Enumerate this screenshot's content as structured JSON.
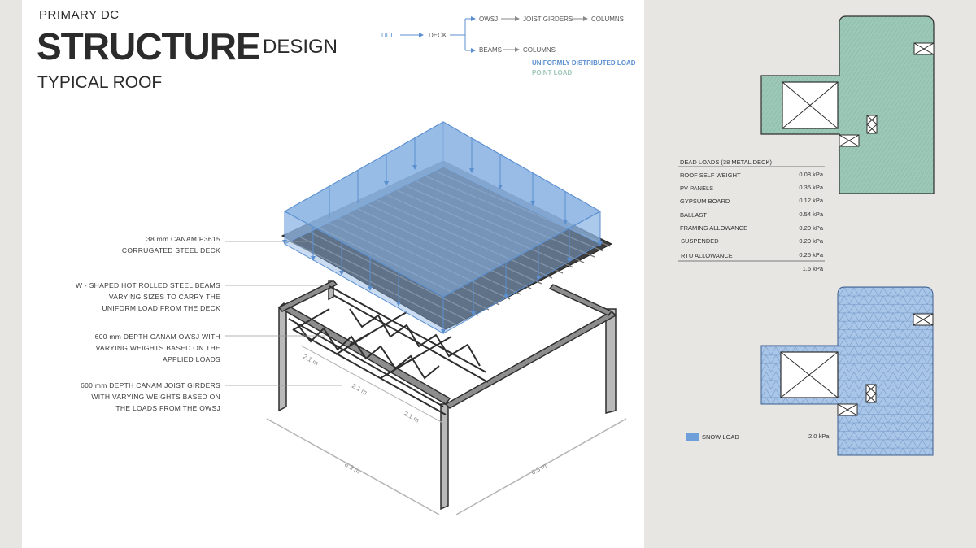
{
  "header": {
    "kicker": "PRIMARY DC",
    "title": "STRUCTURE",
    "title_suffix": "DESIGN",
    "subtitle": "TYPICAL ROOF"
  },
  "load_path": {
    "start": "UDL",
    "deck": "DECK",
    "owsj": "OWSJ",
    "joist_girders": "JOIST GIRDERS",
    "columns_top": "COLUMNS",
    "beams": "BEAMS",
    "columns_bottom": "COLUMNS"
  },
  "legend": {
    "udl": "UNIFORMLY DISTRIBUTED LOAD",
    "point": "POINT LOAD"
  },
  "callouts": {
    "deck": [
      "38 mm CANAM P3615",
      "CORRUGATED STEEL DECK"
    ],
    "beams": [
      "W - SHAPED HOT ROLLED STEEL BEAMS",
      "VARYING SIZES TO CARRY THE",
      "UNIFORM LOAD FROM THE DECK"
    ],
    "owsj": [
      "600 mm DEPTH CANAM OWSJ WITH",
      "VARYING WEIGHTS BASED ON THE",
      "APPLIED LOADS"
    ],
    "girders": [
      "600 mm DEPTH CANAM JOIST GIRDERS",
      "WITH VARYING WEIGHTS BASED ON",
      "THE LOADS FROM THE OWSJ"
    ]
  },
  "dimensions": {
    "bay_spacing": "2.1 m",
    "width": "6.3 m",
    "depth": "6.3 m"
  },
  "dead_loads": {
    "title": "DEAD LOADS (38 METAL DECK)",
    "rows": [
      {
        "label": "ROOF SELF WEIGHT",
        "value": "0.08 kPa"
      },
      {
        "label": "PV PANELS",
        "value": "0.35 kPa"
      },
      {
        "label": "GYPSUM BOARD",
        "value": "0.12 kPa"
      },
      {
        "label": "BALLAST",
        "value": "0.54 kPa"
      },
      {
        "label": "FRAMING ALLOWANCE",
        "value": "0.20 kPa"
      },
      {
        "label": "SUSPENDED",
        "value": "0.20 kPa"
      },
      {
        "label": "RTU ALLOWANCE",
        "value": "0.25 kPa"
      }
    ],
    "total": "1.6 kPa"
  },
  "snow_load": {
    "label": "SNOW LOAD",
    "value": "2.0 kPa"
  },
  "colors": {
    "udl_blue": "#5b8fd0",
    "point_green": "#9fc8b8",
    "dead_load_fill": "#9cc8b7",
    "snow_fill": "#a9c6e8",
    "snow_key": "#6e9fd8"
  }
}
